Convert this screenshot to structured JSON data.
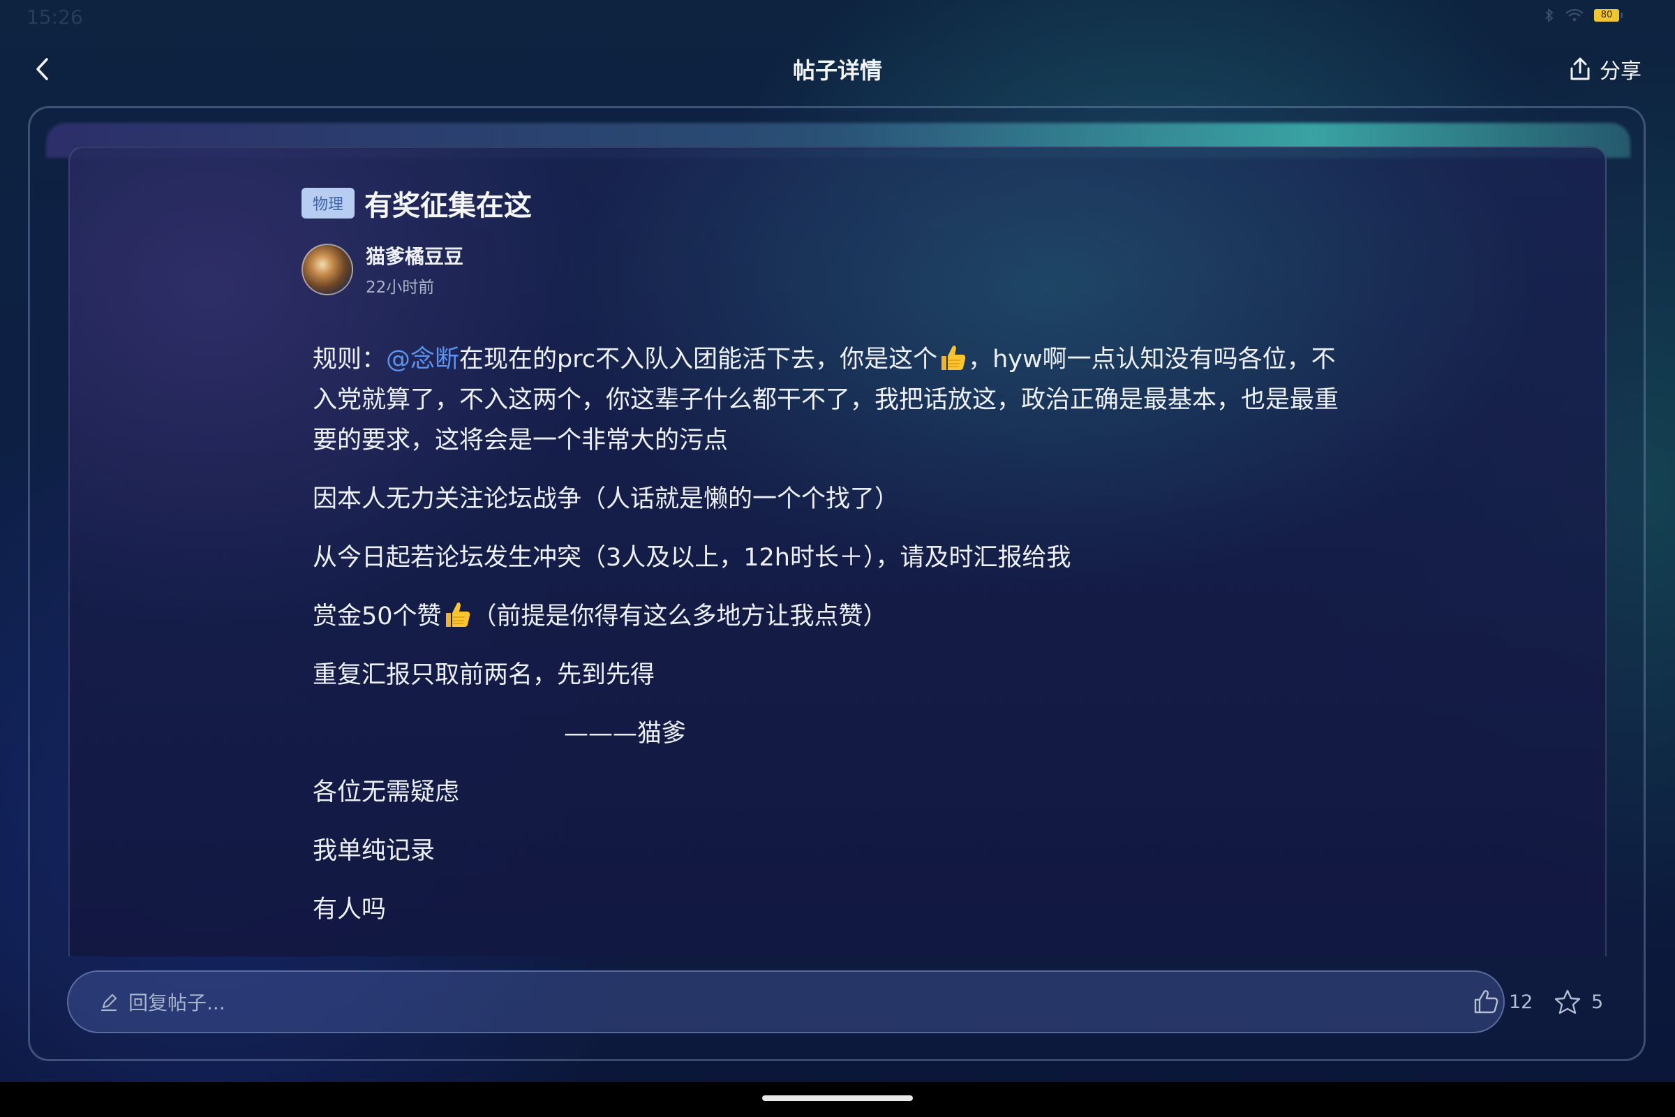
{
  "status_bar": {
    "time": "15:26",
    "battery": "80"
  },
  "header": {
    "title": "帖子详情",
    "share_label": "分享"
  },
  "post": {
    "tag": "物理",
    "title": "有奖征集在这",
    "author": "猫爹橘豆豆",
    "time": "22小时前",
    "body": {
      "p1_prefix": "规则：",
      "p1_mention": "@念断",
      "p1_text_a": "在现在的prc不入队入团能活下去，你是这个",
      "p1_text_b": "，hyw啊一点认知没有吗各位，不入党就算了，不入这两个，你这辈子什么都干不了，我把话放这，政治正确是最基本，也是最重要的要求，这将会是一个非常大的污点",
      "p2": "因本人无力关注论坛战争（人话就是懒的一个个找了）",
      "p3": "从今日起若论坛发生冲突（3人及以上，12h时长＋），请及时汇报给我",
      "p4_text_a": "赏金50个赞",
      "p4_text_b": "（前提是你得有这么多地方让我点赞）",
      "p5": "重复汇报只取前两名，先到先得",
      "p6": "———猫爹",
      "p7": "各位无需疑虑",
      "p8": "我单纯记录",
      "p9": "有人吗"
    }
  },
  "reply_bar": {
    "placeholder": "回复帖子..."
  },
  "actions": {
    "likes": "12",
    "favorites": "5"
  },
  "colors": {
    "mention": "#5a93f0",
    "tag_bg": "#b7cdf2",
    "tag_text": "#3c64a8"
  },
  "icons": [
    "back-icon",
    "share-icon",
    "pencil-icon",
    "thumbs-up-icon",
    "star-icon",
    "thumbs-up-emoji-icon",
    "bluetooth-icon",
    "wifi-icon",
    "battery-icon"
  ]
}
